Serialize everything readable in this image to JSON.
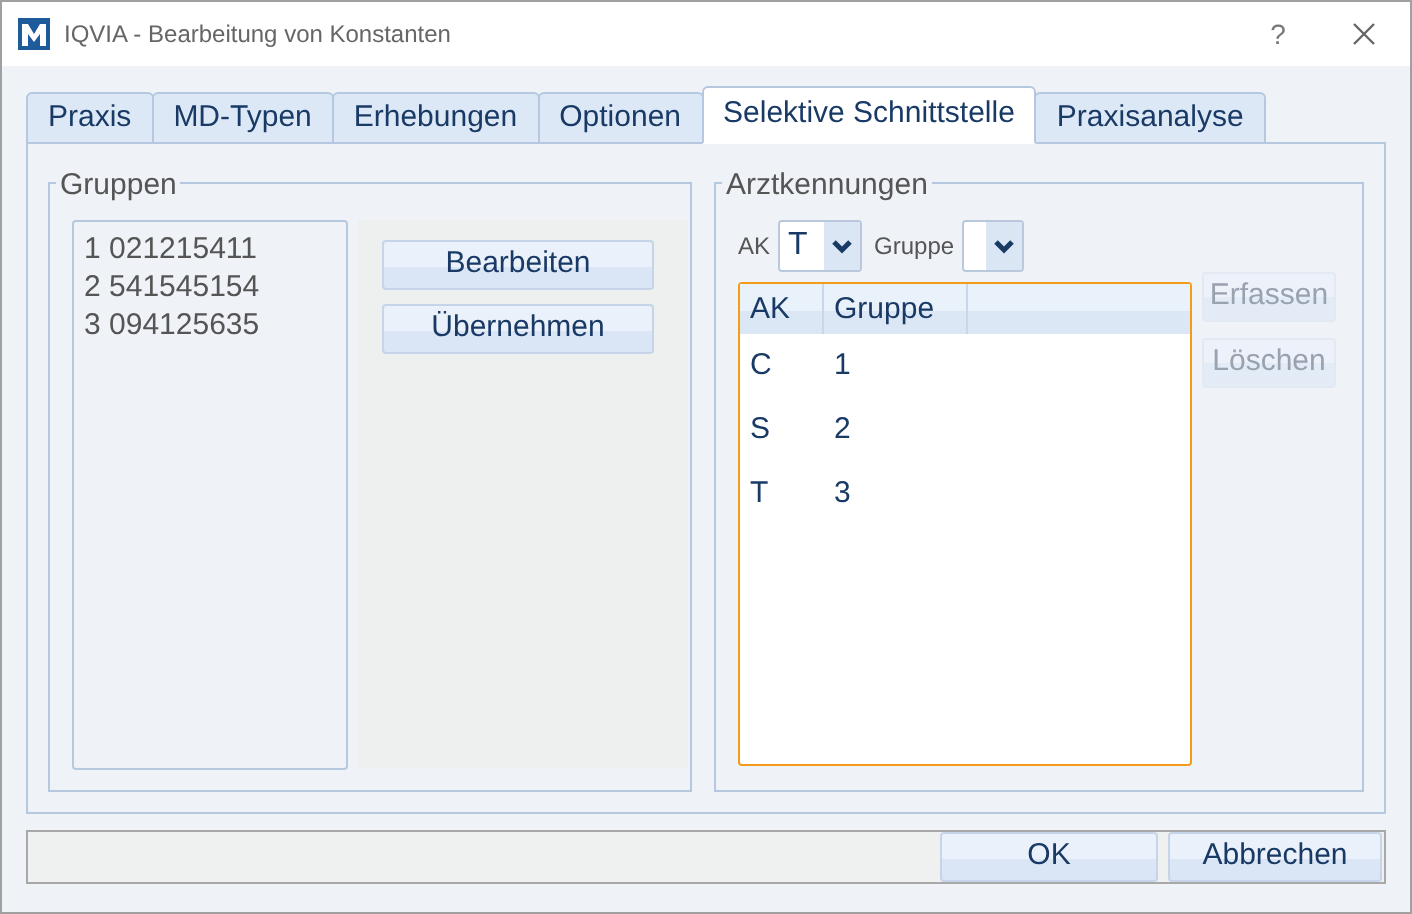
{
  "window": {
    "title": "IQVIA - Bearbeitung von Konstanten",
    "help": "?"
  },
  "tabs": [
    {
      "label": "Praxis",
      "selected": false
    },
    {
      "label": "MD-Typen",
      "selected": false
    },
    {
      "label": "Erhebungen",
      "selected": false
    },
    {
      "label": "Optionen",
      "selected": false
    },
    {
      "label": "Selektive Schnittstelle",
      "selected": true
    },
    {
      "label": "Praxisanalyse",
      "selected": false
    }
  ],
  "gruppen": {
    "title": "Gruppen",
    "items": [
      "1 021215411",
      "2 541545154",
      "3 094125635"
    ],
    "buttons": [
      {
        "label": "Bearbeiten",
        "disabled": false
      },
      {
        "label": "Übernehmen",
        "disabled": false
      }
    ]
  },
  "arztkennungen": {
    "title": "Arztkennungen",
    "ak_label": "AK",
    "ak_value": "T",
    "gruppe_label": "Gruppe",
    "buttons": [
      {
        "label": "Erfassen",
        "disabled": true
      },
      {
        "label": "Löschen",
        "disabled": true
      }
    ],
    "table": {
      "columns": [
        "AK",
        "Gruppe"
      ],
      "rows": [
        [
          "C",
          "1"
        ],
        [
          "S",
          "2"
        ],
        [
          "T",
          "3"
        ]
      ]
    }
  },
  "footer": {
    "buttons": [
      {
        "label": "OK",
        "disabled": false
      },
      {
        "label": "Abbrechen",
        "disabled": false
      }
    ]
  }
}
